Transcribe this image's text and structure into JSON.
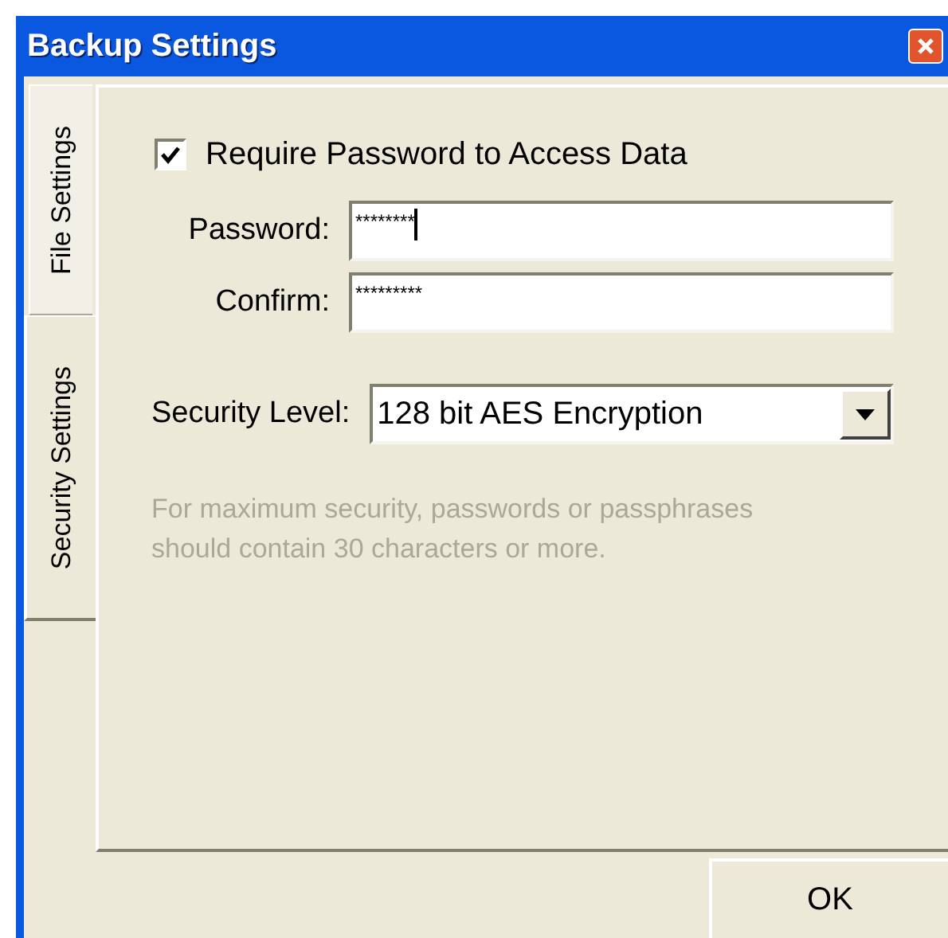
{
  "window": {
    "title": "Backup Settings"
  },
  "tabs": [
    {
      "label": "File Settings",
      "selected": false
    },
    {
      "label": "Security Settings",
      "selected": true
    }
  ],
  "require_password": {
    "label": "Require Password to Access Data",
    "checked": true
  },
  "fields": [
    {
      "label": "Password:",
      "value": "********",
      "focused": true
    },
    {
      "label": "Confirm:",
      "value": "*********",
      "focused": false
    }
  ],
  "security_level": {
    "label": "Security Level:",
    "value": "128 bit AES Encryption"
  },
  "hint": "For maximum security, passwords or passphrases should contain 30 characters or more.",
  "buttons": [
    "OK"
  ]
}
